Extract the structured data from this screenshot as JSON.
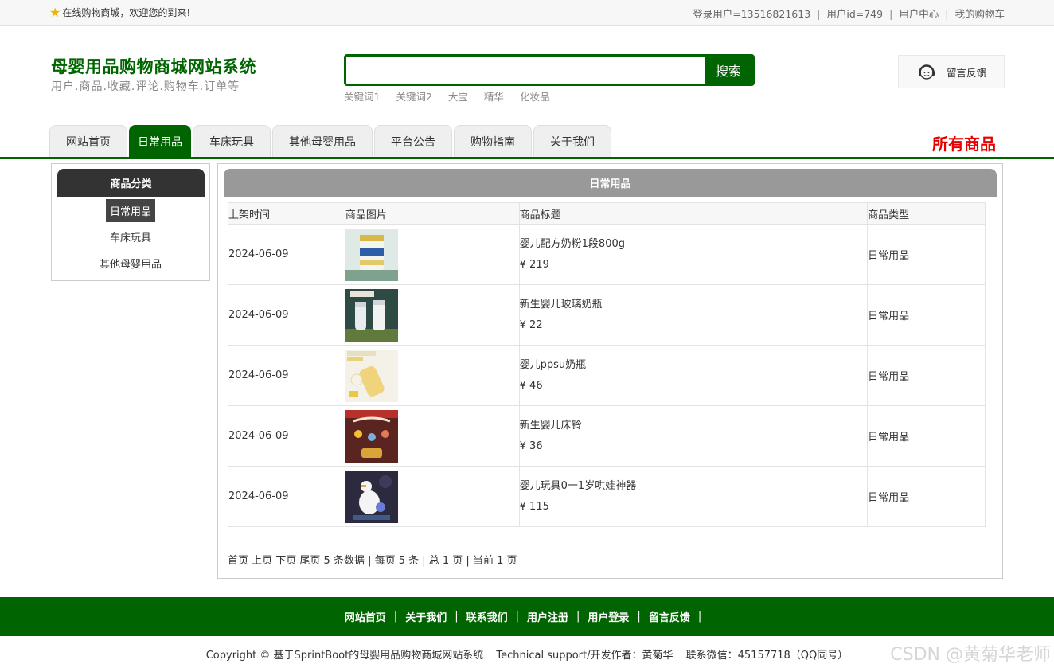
{
  "topbar": {
    "welcome": "在线购物商城，欢迎您的到来!",
    "user_login": "登录用户=13516821613",
    "user_id": "用户id=749",
    "user_center": "用户中心",
    "cart": "我的购物车",
    "separator": "|"
  },
  "header": {
    "title": "母婴用品购物商城网站系统",
    "subtitle": "用户.商品.收藏.评论.购物车.订单等",
    "search_value": "",
    "search_button": "搜索",
    "keywords": [
      "关键词1",
      "关键词2",
      "大宝",
      "精华",
      "化妆品"
    ],
    "feedback": "留言反馈"
  },
  "nav": {
    "tabs": [
      "网站首页",
      "日常用品",
      "车床玩具",
      "其他母婴用品",
      "平台公告",
      "购物指南",
      "关于我们"
    ],
    "active_index": 1,
    "all_goods": "所有商品"
  },
  "sidebar": {
    "title": "商品分类",
    "items": [
      "日常用品",
      "车床玩具",
      "其他母婴用品"
    ]
  },
  "main": {
    "title": "日常用品",
    "columns": [
      "上架时间",
      "商品图片",
      "商品标题",
      "商品类型"
    ],
    "rows": [
      {
        "date": "2024-06-09",
        "name": "婴儿配方奶粉1段800g",
        "price": "¥ 219",
        "type": "日常用品"
      },
      {
        "date": "2024-06-09",
        "name": "新生婴儿玻璃奶瓶",
        "price": "¥ 22",
        "type": "日常用品"
      },
      {
        "date": "2024-06-09",
        "name": "婴儿ppsu奶瓶",
        "price": "¥ 46",
        "type": "日常用品"
      },
      {
        "date": "2024-06-09",
        "name": "新生婴儿床铃",
        "price": "¥ 36",
        "type": "日常用品"
      },
      {
        "date": "2024-06-09",
        "name": "婴儿玩具0一1岁哄娃神器",
        "price": "¥ 115",
        "type": "日常用品"
      }
    ],
    "pager": "首页 上页 下页 尾页 5 条数据 | 每页 5 条 | 总 1 页 | 当前 1 页"
  },
  "footer": {
    "links": [
      "网站首页",
      "关于我们",
      "联系我们",
      "用户注册",
      "用户登录",
      "留言反馈"
    ],
    "copyright": "Copyright © 基于SprintBoot的母婴用品购物商城网站系统",
    "support": "Technical support/开发作者：黄菊华",
    "contact": "联系微信：45157718（QQ同号）",
    "watermark": "CSDN @黄菊华老师"
  },
  "colors": {
    "brand_green": "#006400",
    "all_goods_red": "#e60000",
    "sidebar_head": "#333333",
    "main_head": "#999999"
  }
}
